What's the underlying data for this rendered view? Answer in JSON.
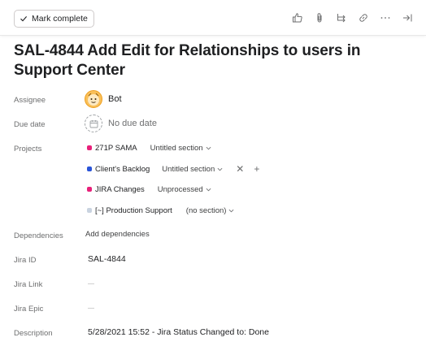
{
  "toolbar": {
    "mark_complete_label": "Mark complete",
    "icons": [
      "thumbs-up-icon",
      "paperclip-icon",
      "subtask-icon",
      "link-icon",
      "more-icon",
      "close-pane-icon"
    ]
  },
  "task": {
    "title": "SAL-4844 Add Edit for Relationships to users in Support Center"
  },
  "fields": {
    "assignee_label": "Assignee",
    "assignee_name": "Bot",
    "due_date_label": "Due date",
    "due_date_value": "No due date",
    "projects_label": "Projects",
    "dependencies_label": "Dependencies",
    "add_dependencies": "Add dependencies",
    "jira_id_label": "Jira ID",
    "jira_id_value": "SAL-4844",
    "jira_link_label": "Jira Link",
    "jira_epic_label": "Jira Epic",
    "description_label": "Description",
    "description_value": "5/28/2021 15:52 - Jira Status Changed to:  Done"
  },
  "projects": [
    {
      "name": "271P SAMA",
      "section": "Untitled section",
      "color": "#e8207a"
    },
    {
      "name": "Client's Backlog",
      "section": "Untitled section",
      "color": "#2a54d8",
      "actions": {
        "remove": "✕",
        "add": "+"
      }
    },
    {
      "name": "JIRA Changes",
      "section": "Unprocessed",
      "color": "#e8207a"
    },
    {
      "name": "[~] Production Support",
      "section": "(no section)",
      "color": "#c9d3e0"
    }
  ]
}
